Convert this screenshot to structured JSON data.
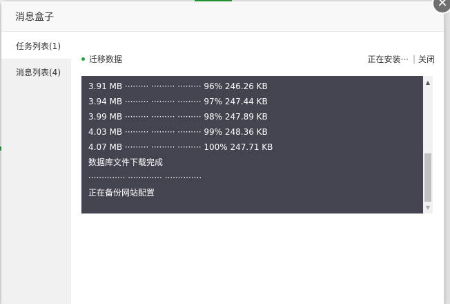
{
  "dialog": {
    "title": "消息盒子",
    "close_glyph": "✕"
  },
  "sidebar": {
    "items": [
      {
        "label": "任务列表(1)"
      },
      {
        "label": "消息列表(4)"
      }
    ]
  },
  "task": {
    "name": "迁移数据",
    "status": "正在安装···",
    "close_label": "关闭",
    "separator": "|"
  },
  "console": {
    "lines": [
      "3.91 MB ········· ········· ········· 96% 246.26 KB",
      "3.94 MB ········· ········· ········· 97% 247.44 KB",
      "3.99 MB ········· ········· ········· 98% 247.89 KB",
      "4.03 MB ········· ········· ········· 99% 248.36 KB",
      "4.07 MB ········· ········· ········· 100% 247.71 KB",
      "数据库文件下载完成",
      "·············· ············· ··············",
      "正在备份网站配置"
    ]
  },
  "scrollbar": {
    "up_glyph": "▲",
    "down_glyph": "▼"
  }
}
